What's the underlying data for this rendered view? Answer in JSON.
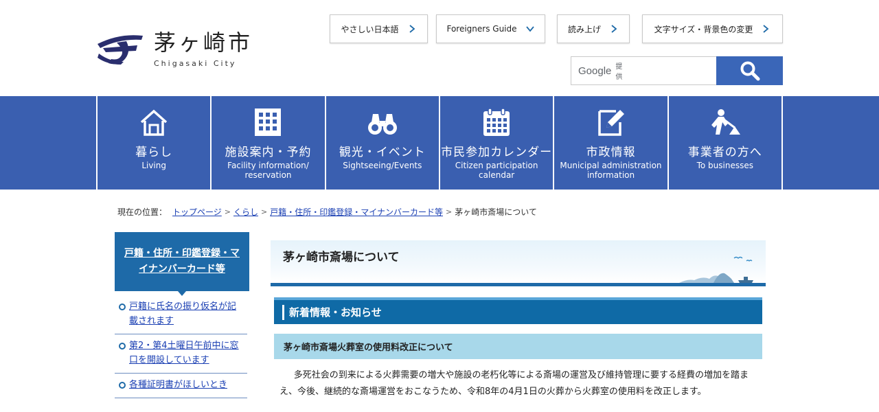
{
  "header": {
    "logo_name": "茅ヶ崎市",
    "logo_roman": "Chigasaki City",
    "utility_links": [
      {
        "label": "やさしい日本語"
      },
      {
        "label": "Foreigners Guide"
      },
      {
        "label": "読み上げ"
      },
      {
        "label": "文字サイズ・背景色の変更"
      }
    ],
    "search": {
      "provider": "Google",
      "provided_label": "提供",
      "value": "",
      "button_icon": "search-icon"
    }
  },
  "colors": {
    "nav_bg": "#3a5fb0",
    "accent": "#1e6aa8",
    "link": "#1a3fb3",
    "news_bg": "#0f6aa6",
    "sub_bg": "#a8d8ea"
  },
  "nav": [
    {
      "ja": "暮らし",
      "en": "Living",
      "icon": "house-icon"
    },
    {
      "ja": "施設案内・予約",
      "en": "Facility information/ reservation",
      "icon": "building-icon"
    },
    {
      "ja": "観光・イベント",
      "en": "Sightseeing/Events",
      "icon": "binoculars-icon"
    },
    {
      "ja": "市民参加カレンダー",
      "en": "Citizen participation calendar",
      "icon": "calendar-icon"
    },
    {
      "ja": "市政情報",
      "en": "Municipal administration information",
      "icon": "pen-document-icon"
    },
    {
      "ja": "事業者の方へ",
      "en": "To businesses",
      "icon": "worker-icon"
    }
  ],
  "breadcrumb": {
    "prefix": "現在の位置：",
    "links": [
      "トップページ",
      "くらし",
      "戸籍・住所・印鑑登録・マイナンバーカード等"
    ],
    "current": "茅ヶ崎市斎場について"
  },
  "side": {
    "heading": "戸籍・住所・印鑑登録・マイナンバーカード等",
    "items": [
      {
        "label": "戸籍に氏名の振り仮名が記載されます"
      },
      {
        "label": "第2・第4土曜日午前中に窓口を開設しています"
      },
      {
        "label": "各種証明書がほしいとき"
      }
    ]
  },
  "main": {
    "title": "茅ヶ崎市斎場について",
    "news_heading": "新着情報・お知らせ",
    "sub_heading": "茅ヶ崎市斎場火葬室の使用料改正について",
    "body": "多死社会の到来による火葬需要の増大や施設の老朽化等による斎場の運営及び維持管理に要する経費の増加を踏まえ、今後、継続的な斎場運営をおこなうため、令和8年の4月1日の火葬から火葬室の使用料を改正します。"
  }
}
